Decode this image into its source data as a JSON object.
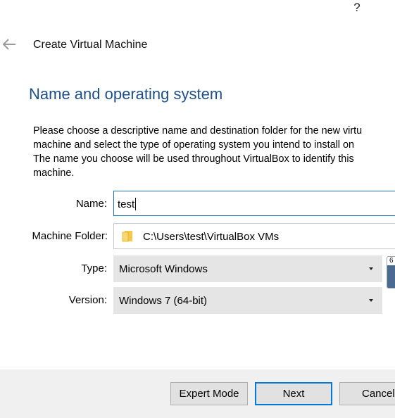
{
  "window": {
    "help_glyph": "?"
  },
  "header": {
    "back_icon": "arrow-left-icon",
    "title": "Create Virtual Machine"
  },
  "section": {
    "heading": "Name and operating system",
    "description_lines": [
      "Please choose a descriptive name and destination folder for the new virtu",
      "machine and select the type of operating system you intend to install on",
      "The name you choose will be used throughout VirtualBox to identify this",
      "machine."
    ]
  },
  "form": {
    "name": {
      "label": "Name:",
      "value": "test"
    },
    "machine_folder": {
      "label": "Machine Folder:",
      "icon": "folder-icon",
      "value": "C:\\Users\\test\\VirtualBox VMs"
    },
    "type": {
      "label": "Type:",
      "selected": "Microsoft Windows"
    },
    "version": {
      "label": "Version:",
      "selected": "Windows 7 (64-bit)"
    },
    "os_badge": {
      "text": "6"
    }
  },
  "buttons": {
    "expert_mode": "Expert Mode",
    "next": "Next",
    "cancel": "Cancel"
  },
  "colors": {
    "heading": "#1f4f86",
    "focus_border": "#1a6fb5",
    "default_button_border": "#0078d7",
    "footer_background": "#f0f0f0",
    "select_background": "#e5e5e5"
  }
}
